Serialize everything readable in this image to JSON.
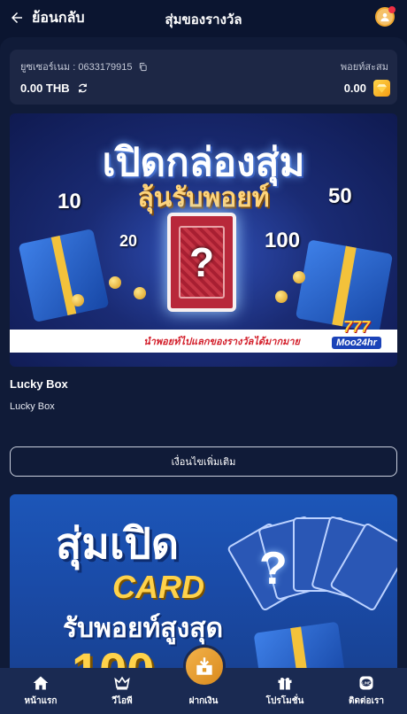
{
  "header": {
    "back_label": "ย้อนกลับ",
    "title": "สุ่มของรางวัล",
    "avatar_icon": "user-avatar-icon",
    "notification_color": "#ef2f44"
  },
  "account": {
    "username_label": "ยูซเซอร์เนม : 0633179915",
    "points_label": "พอยท์สะสม",
    "balance": "0.00 THB",
    "points": "0.00"
  },
  "banner1": {
    "title": "เปิดกล่องสุ่ม",
    "subtitle": "ลุ้นรับพอยท์",
    "numbers": [
      "10",
      "50",
      "20",
      "100"
    ],
    "card_symbol": "?",
    "strip_text": "นำพอยท์ไปแลกของรางวัลได้มากมาย",
    "logo_top": "777",
    "logo_bottom": "Moo24hr"
  },
  "item": {
    "title": "Lucky Box",
    "description": "Lucky Box"
  },
  "conditions_button": "เงื่อนไขเพิ่มเติม",
  "banner2": {
    "line1": "สุ่มเปิด",
    "line2": "CARD",
    "line3": "รับพอยท์สูงสุด",
    "line4": "100",
    "card_symbol": "?"
  },
  "nav": {
    "items": [
      {
        "label": "หน้าแรก",
        "icon": "home-icon"
      },
      {
        "label": "วีไอพี",
        "icon": "crown-icon"
      },
      {
        "label": "ฝากเงิน",
        "icon": "deposit-icon"
      },
      {
        "label": "โปรโมชั่น",
        "icon": "gift-icon"
      },
      {
        "label": "ติดต่อเรา",
        "icon": "line-chat-icon"
      }
    ]
  },
  "colors": {
    "background": "#0b1530",
    "panel": "#101b38",
    "card": "#1d2745",
    "nav": "#1a2a52",
    "accent": "#f3b24a"
  }
}
